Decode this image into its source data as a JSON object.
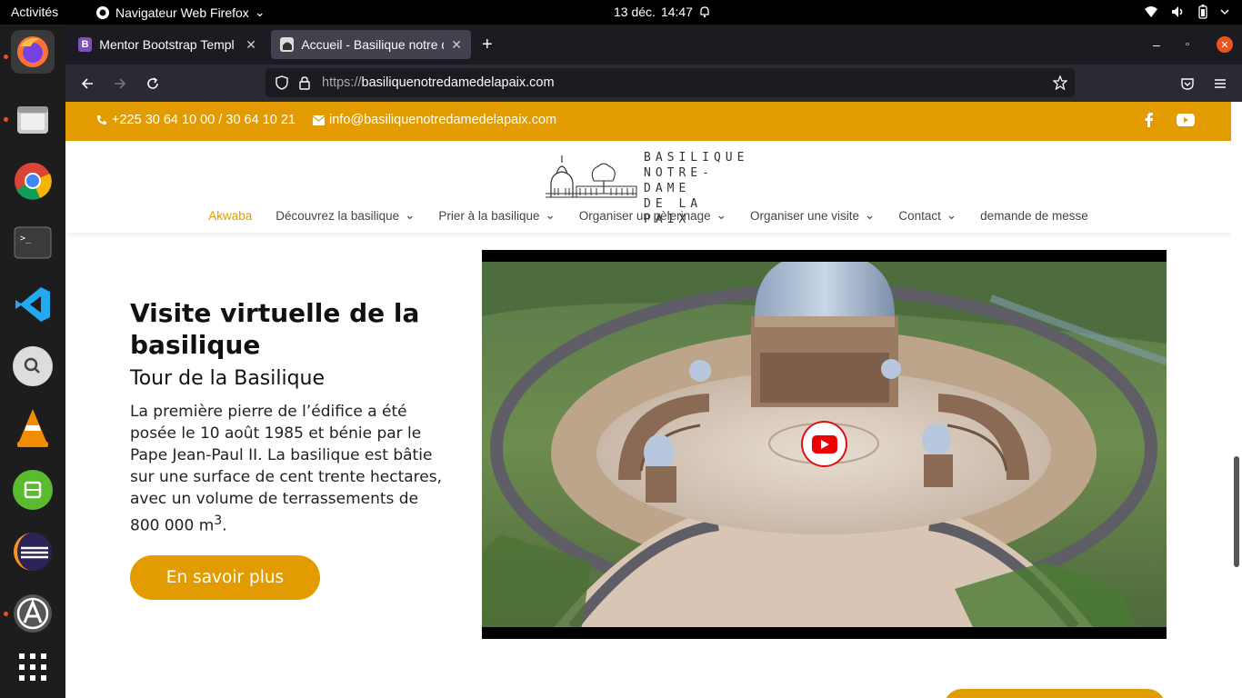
{
  "system": {
    "activities": "Activités",
    "app_name": "Navigateur Web Firefox",
    "date": "13 déc.",
    "time": "14:47"
  },
  "dock": {
    "items": [
      "firefox-icon",
      "files-icon",
      "chrome-icon",
      "terminal-icon",
      "vscode-icon",
      "search-icon",
      "vlc-icon",
      "software-icon",
      "eclipse-icon",
      "updater-icon",
      "show-apps-icon"
    ]
  },
  "browser": {
    "tabs": [
      {
        "title": "Mentor Bootstrap Templ",
        "favicon": "B",
        "active": false
      },
      {
        "title": "Accueil - Basilique notre d",
        "favicon": "basilica",
        "active": true
      }
    ],
    "url_protocol": "https://",
    "url_host": "basiliquenotredamedelapaix.com"
  },
  "site": {
    "phone": "+225 30 64 10 00 / 30 64 10 21",
    "email": "info@basiliquenotredamedelapaix.com",
    "logo_lines": [
      "BASILIQUE",
      "NOTRE-DAME",
      "DE LA PAIX"
    ],
    "menu": [
      {
        "label": "Akwaba",
        "active": true,
        "dropdown": false
      },
      {
        "label": "Découvrez la basilique",
        "active": false,
        "dropdown": true
      },
      {
        "label": "Prier à la basilique",
        "active": false,
        "dropdown": true
      },
      {
        "label": "Organiser un pèlerinage",
        "active": false,
        "dropdown": true
      },
      {
        "label": "Organiser une visite",
        "active": false,
        "dropdown": true
      },
      {
        "label": "Contact",
        "active": false,
        "dropdown": true
      },
      {
        "label": "demande de messe",
        "active": false,
        "dropdown": false
      }
    ],
    "hero": {
      "title": "Visite virtuelle de la basilique",
      "subtitle": "Tour de la Basilique",
      "text": "La première pierre de l’édifice a été posée le 10 août 1985 et bénie par le Pape Jean-Paul II. La basilique est bâtie sur une surface de cent trente hectares, avec un volume de terrassements de 800 000 m",
      "text_sup": "3",
      "text_end": ".",
      "cta": "En savoir plus"
    },
    "accent_color": "#e29b00"
  }
}
